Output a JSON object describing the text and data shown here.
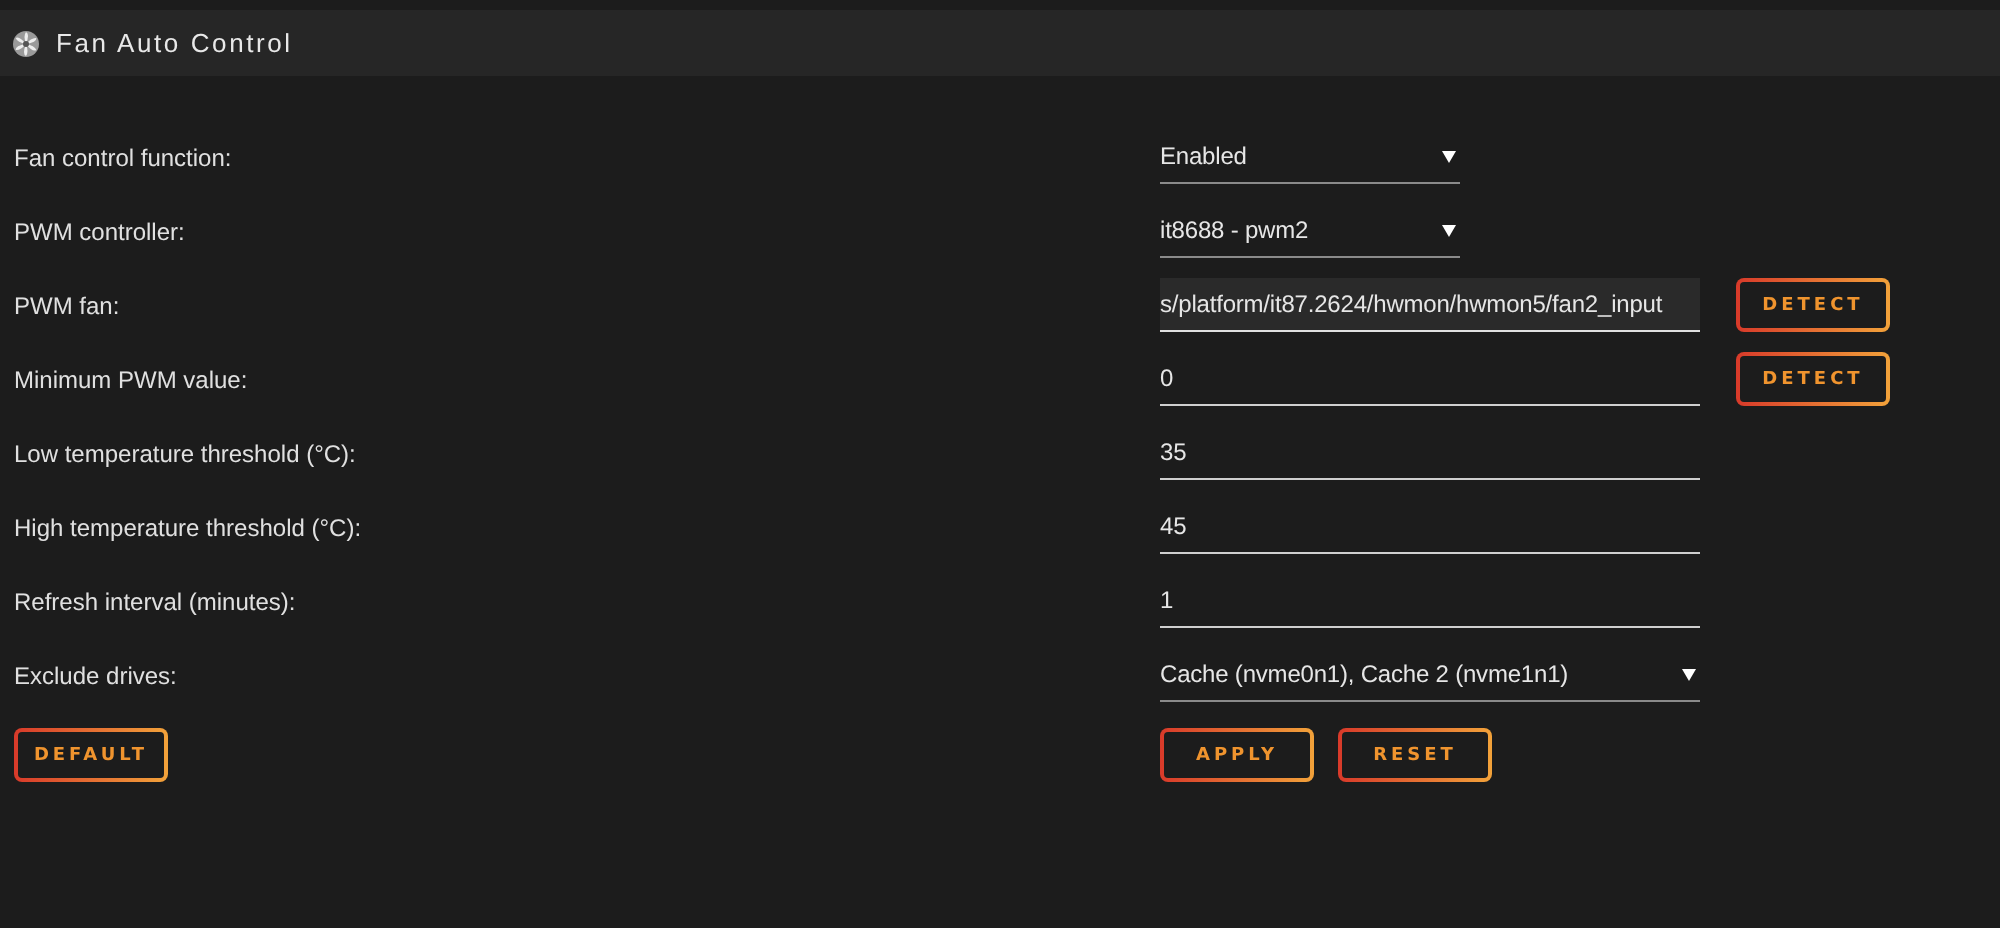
{
  "panel": {
    "title": "Fan Auto Control"
  },
  "settings": [
    {
      "label": "Fan control function:",
      "kind": "select",
      "value": "Enabled"
    },
    {
      "label": "PWM controller:",
      "kind": "select",
      "value": "it8688 - pwm2"
    },
    {
      "label": "PWM fan:",
      "kind": "input",
      "value": "s/platform/it87.2624/hwmon/hwmon5/fan2_input",
      "focused": true,
      "button": "DETECT"
    },
    {
      "label": "Minimum PWM value:",
      "kind": "input",
      "value": "0",
      "focused": false,
      "button": "DETECT"
    },
    {
      "label": "Low temperature threshold (°C):",
      "kind": "input",
      "value": "35",
      "focused": false
    },
    {
      "label": "High temperature threshold (°C):",
      "kind": "input",
      "value": "45",
      "focused": false
    },
    {
      "label": "Refresh interval (minutes):",
      "kind": "input",
      "value": "1",
      "focused": false
    },
    {
      "label": "Exclude drives:",
      "kind": "multiselect",
      "value": "Cache (nvme0n1), Cache 2 (nvme1n1)"
    }
  ],
  "left_buttons": [
    "DEFAULT"
  ],
  "right_buttons": [
    "APPLY",
    "RESET"
  ]
}
